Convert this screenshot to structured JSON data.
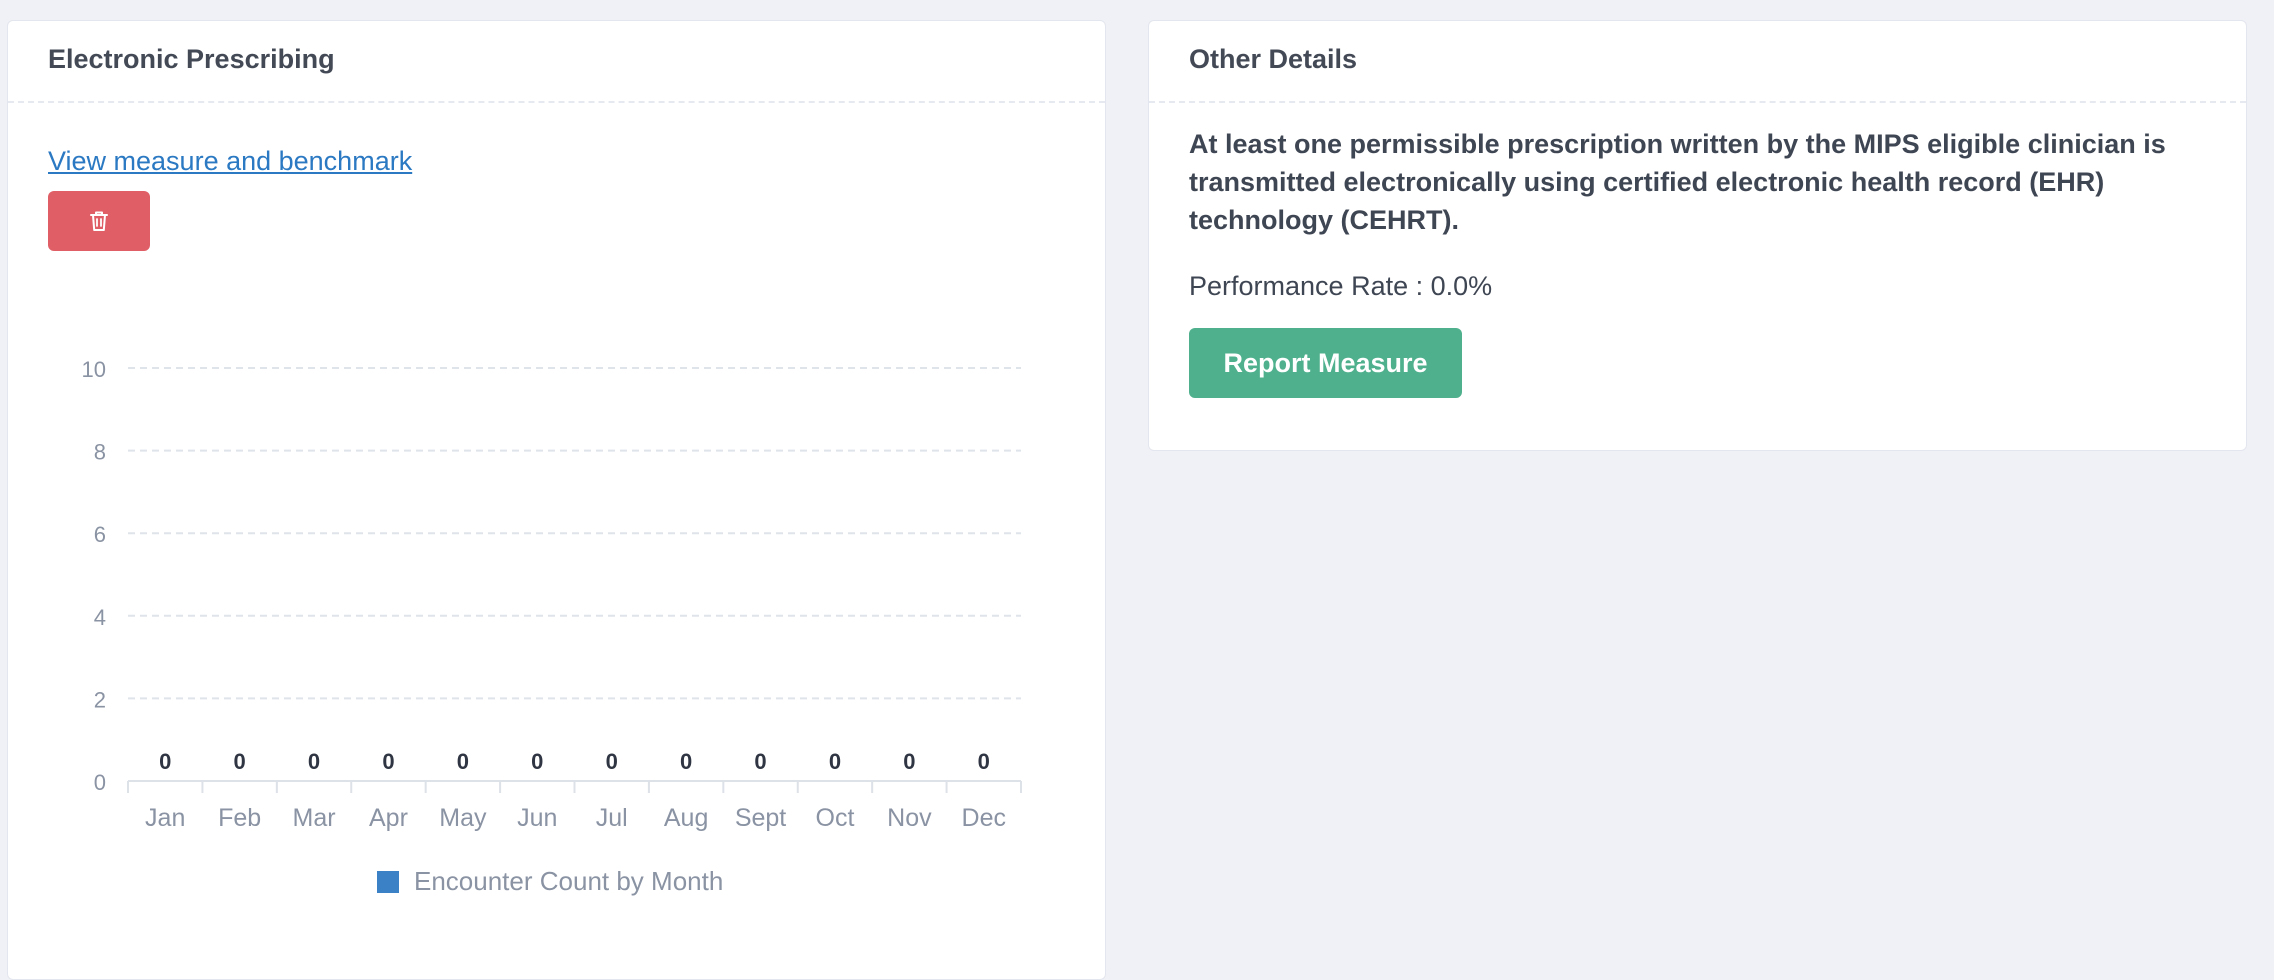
{
  "left_card": {
    "title": "Electronic Prescribing",
    "benchmark_link": "View measure and benchmark",
    "delete_icon": "trash-icon"
  },
  "right_card": {
    "title": "Other Details",
    "description": "At least one permissible prescription written by the MIPS eligible clinician is transmitted electronically using certified electronic health record (EHR) technology (CEHRT).",
    "performance_rate_label": "Performance Rate : 0.0%",
    "report_button": "Report Measure"
  },
  "colors": {
    "series": "#3a81c5",
    "delete_button": "#e05f67",
    "report_button": "#4fb08d",
    "link": "#2b79c2"
  },
  "chart_data": {
    "type": "bar",
    "categories": [
      "Jan",
      "Feb",
      "Mar",
      "Apr",
      "May",
      "Jun",
      "Jul",
      "Aug",
      "Sept",
      "Oct",
      "Nov",
      "Dec"
    ],
    "series": [
      {
        "name": "Encounter Count by Month",
        "values": [
          0,
          0,
          0,
          0,
          0,
          0,
          0,
          0,
          0,
          0,
          0,
          0
        ]
      }
    ],
    "y_ticks": [
      0,
      2,
      4,
      6,
      8,
      10
    ],
    "ylim": [
      0,
      10
    ],
    "grid": true,
    "legend_position": "bottom",
    "data_labels": true
  }
}
